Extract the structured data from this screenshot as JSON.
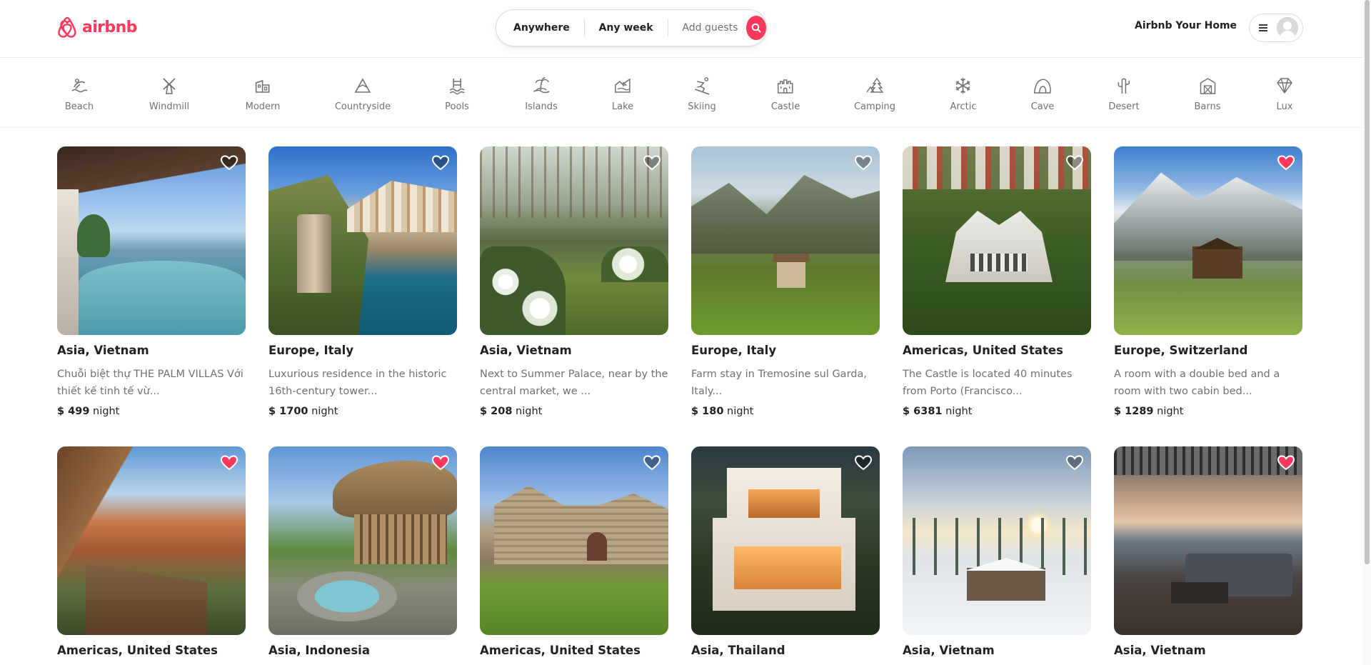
{
  "brand": {
    "name": "airbnb",
    "color": "#ff385c"
  },
  "search": {
    "where": "Anywhere",
    "when": "Any week",
    "who": "Add guests",
    "button_icon": "search-icon"
  },
  "header": {
    "host_link": "Airbnb Your Home",
    "menu_icon": "hamburger-menu-icon",
    "avatar_icon": "user-avatar-icon"
  },
  "categories": [
    {
      "label": "Beach",
      "icon": "beach-icon"
    },
    {
      "label": "Windmill",
      "icon": "windmill-icon"
    },
    {
      "label": "Modern",
      "icon": "modern-house-icon"
    },
    {
      "label": "Countryside",
      "icon": "countryside-icon"
    },
    {
      "label": "Pools",
      "icon": "pool-icon"
    },
    {
      "label": "Islands",
      "icon": "island-icon"
    },
    {
      "label": "Lake",
      "icon": "lake-icon"
    },
    {
      "label": "Skiing",
      "icon": "skiing-icon"
    },
    {
      "label": "Castle",
      "icon": "castle-icon"
    },
    {
      "label": "Camping",
      "icon": "camping-icon"
    },
    {
      "label": "Arctic",
      "icon": "snowflake-icon"
    },
    {
      "label": "Cave",
      "icon": "cave-icon"
    },
    {
      "label": "Desert",
      "icon": "cactus-icon"
    },
    {
      "label": "Barns",
      "icon": "barn-icon"
    },
    {
      "label": "Lux",
      "icon": "diamond-icon"
    }
  ],
  "listings": [
    {
      "location": "Asia, Vietnam",
      "description": "Chuỗi biệt thự THE PALM VILLAS Với thiết kế tinh tế vừ...",
      "price": "$ 499",
      "unit": "night",
      "favorited": false
    },
    {
      "location": "Europe, Italy",
      "description": "Luxurious residence in the historic 16th-century tower...",
      "price": "$ 1700",
      "unit": "night",
      "favorited": false
    },
    {
      "location": "Asia, Vietnam",
      "description": "Next to Summer Palace, near by the central market, we ...",
      "price": "$ 208",
      "unit": "night",
      "favorited": false
    },
    {
      "location": "Europe, Italy",
      "description": "Farm stay in Tremosine sul Garda, Italy...",
      "price": "$ 180",
      "unit": "night",
      "favorited": false
    },
    {
      "location": "Americas, United States",
      "description": "The Castle is located 40 minutes from Porto (Francisco...",
      "price": "$ 6381",
      "unit": "night",
      "favorited": false
    },
    {
      "location": "Europe, Switzerland",
      "description": "A room with a double bed and a room with two cabin bed...",
      "price": "$ 1289",
      "unit": "night",
      "favorited": true
    },
    {
      "location": "Americas, United States",
      "description": "",
      "price": "",
      "unit": "",
      "favorited": true
    },
    {
      "location": "Asia, Indonesia",
      "description": "",
      "price": "",
      "unit": "",
      "favorited": true
    },
    {
      "location": "Americas, United States",
      "description": "",
      "price": "",
      "unit": "",
      "favorited": false
    },
    {
      "location": "Asia, Thailand",
      "description": "",
      "price": "",
      "unit": "",
      "favorited": false
    },
    {
      "location": "Asia, Vietnam",
      "description": "",
      "price": "",
      "unit": "",
      "favorited": false
    },
    {
      "location": "Asia, Vietnam",
      "description": "",
      "price": "",
      "unit": "",
      "favorited": true
    }
  ],
  "colors": {
    "accent": "#ff385c",
    "text": "#222222",
    "muted": "#717171",
    "border": "#dddddd"
  }
}
